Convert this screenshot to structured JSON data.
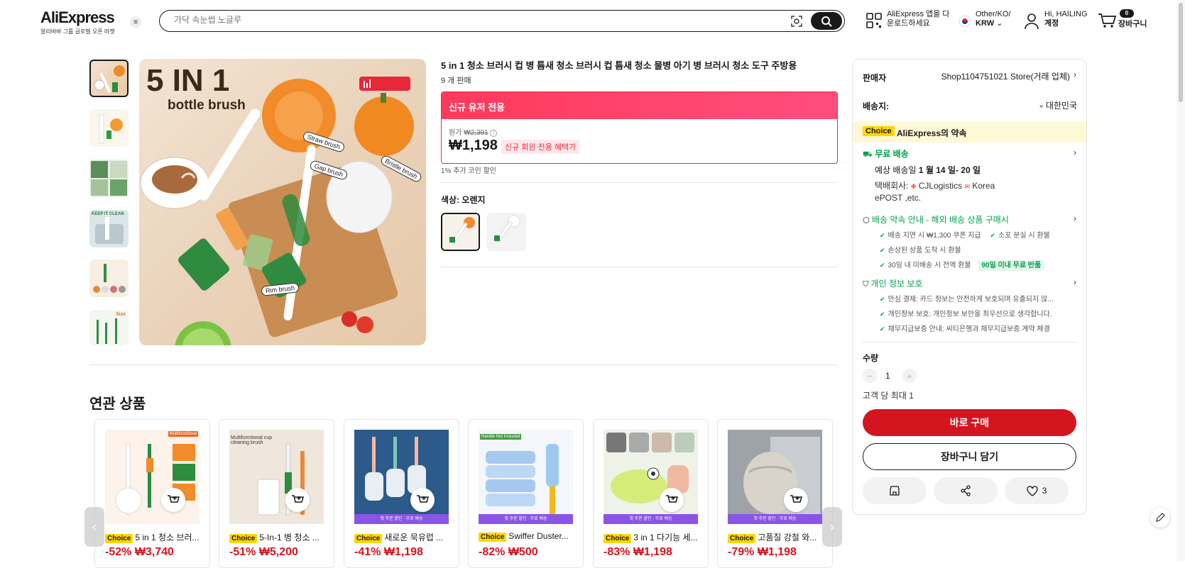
{
  "header": {
    "brand": "AliExpress",
    "brand_sub": "알리바바 그룹 글로벌 오픈 마켓",
    "search_placeholder": "가닥 속눈썹 노글루",
    "app_line1": "AliExpress 앱을 다",
    "app_line2": "운로드하세요",
    "locale_line1": "Other/KO/",
    "locale_line2": "KRW",
    "account_line1": "Hi, HAILING",
    "account_line2": "계정",
    "cart_count": "0",
    "cart_label": "장바구니"
  },
  "product": {
    "title": "5 in 1 청소 브러시 컵 병 틈새 청소 브러시 컵 틈새 청소 물병 아기 병 브러시 청소 도구 주방용",
    "sold": "9 개 판매",
    "promo_banner": "신규 유저 전용",
    "orig_label": "원가",
    "orig_price": "₩2,391",
    "price": "₩1,198",
    "promo_tag": "신규 회원 전용 혜택가",
    "coin_text": "1% 추가 코인 할인",
    "color_label": "색상: 오렌지",
    "image_text": {
      "line1": "5 IN 1",
      "line2": "bottle brush",
      "labels": [
        "Straw brush",
        "Gap brush",
        "Bristle brush",
        "Rim brush"
      ]
    },
    "thumb_labels": [
      "KEEP IT CLEAN",
      "Size"
    ]
  },
  "panel": {
    "seller_label": "판매자",
    "seller_value": "Shop1104751021 Store(거래 업체)",
    "ship_label": "배송지:",
    "ship_value": "대한민국",
    "choice_badge": "Choice",
    "promise": "AliExpress의 약속",
    "free_ship": "무료 배송",
    "eta_prefix": "예상 배송일 ",
    "eta": "1 월 14 일- 20 일",
    "carrier_line1_prefix": "택배회사: ",
    "carrier_a": "CJLogistics",
    "carrier_b": "Korea",
    "carrier_line2": "ePOST ,etc.",
    "delivery_promise": "배송 약속 안내 - 해외 배송 상품 구매시",
    "check1a": "배송 지연 시 ₩1,300 쿠폰 지급",
    "check1b": "소포 분실 시 환불",
    "check2": "손상된 상품 도착 시 환불",
    "check3": "30일 내 미배송 시 전액 환불",
    "check3_tag": "90일 이내 무료 반품",
    "privacy": "개인 정보 보호",
    "privacy1": "안심 결제: 카드 정보는 안전하게 보호되며 유출되지 않...",
    "privacy2": "개인정보 보호: 개인정보 보안을 최우선으로 생각합니다.",
    "privacy3": "채무지급보증 안내: 씨티은행과 채무지급보증 계약 체결",
    "qty_label": "수량",
    "qty_value": "1",
    "qty_limit": "고객 당 최대 1",
    "buy_now": "바로 구매",
    "add_cart": "장바구니 담기",
    "wish_count": "3"
  },
  "related": {
    "title": "연관 상품",
    "strip_text": "첫 주문 할인 · 무료 배송",
    "items": [
      {
        "name": "5 in 1 청소 브러...",
        "disc": "-52%",
        "price": "₩3,740",
        "img_text": "Multifunctional"
      },
      {
        "name": "5-In-1 병 청소 ...",
        "disc": "-51%",
        "price": "₩5,200",
        "img_text": "Multifunctional cup cleaning brush"
      },
      {
        "name": "새로운 묵유럽 ...",
        "disc": "-41%",
        "price": "₩1,198",
        "img_text": ""
      },
      {
        "name": "Swiffer Duster...",
        "disc": "-82%",
        "price": "₩500",
        "img_text": "Handle Not Included"
      },
      {
        "name": "3 in 1 다기능 세...",
        "disc": "-83%",
        "price": "₩1,198",
        "img_text": ""
      },
      {
        "name": "고품질 강철 와...",
        "disc": "-79%",
        "price": "₩1,198",
        "img_text": ""
      }
    ]
  },
  "colors": {
    "red": "#d4151f",
    "pink": "#ff3a5c",
    "green": "#00a04b",
    "choice": "#ffd600",
    "purple": "#8a55e6"
  }
}
